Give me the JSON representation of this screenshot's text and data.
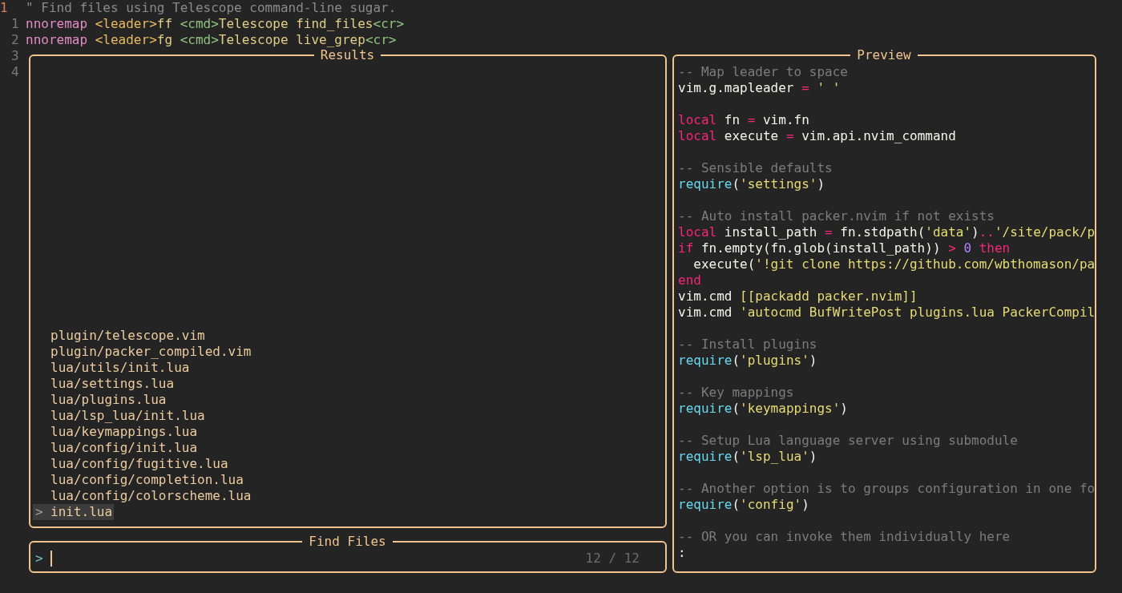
{
  "editor": {
    "lines": [
      {
        "number": "1",
        "current": true,
        "tokens": [
          {
            "kind": "comment",
            "text": "\" Find files using Telescope command-line sugar."
          }
        ]
      },
      {
        "number": "1",
        "current": false,
        "tokens": [
          {
            "kind": "keyword",
            "text": "nnoremap "
          },
          {
            "kind": "special",
            "text": "<leader>"
          },
          {
            "kind": "plain",
            "text": "ff "
          },
          {
            "kind": "tag",
            "text": "<cmd>"
          },
          {
            "kind": "plain",
            "text": "Telescope find_files"
          },
          {
            "kind": "tag",
            "text": "<cr>"
          }
        ]
      },
      {
        "number": "2",
        "current": false,
        "tokens": [
          {
            "kind": "keyword",
            "text": "nnoremap "
          },
          {
            "kind": "special",
            "text": "<leader>"
          },
          {
            "kind": "plain",
            "text": "fg "
          },
          {
            "kind": "tag",
            "text": "<cmd>"
          },
          {
            "kind": "plain",
            "text": "Telescope live_grep"
          },
          {
            "kind": "tag",
            "text": "<cr>"
          }
        ]
      },
      {
        "number": "3",
        "current": false
      },
      {
        "number": "4",
        "current": false
      }
    ]
  },
  "results": {
    "title": "Results",
    "caret": ">",
    "items": [
      {
        "path": "plugin/telescope.vim",
        "selected": false
      },
      {
        "path": "plugin/packer_compiled.vim",
        "selected": false
      },
      {
        "path": "lua/utils/init.lua",
        "selected": false
      },
      {
        "path": "lua/settings.lua",
        "selected": false
      },
      {
        "path": "lua/plugins.lua",
        "selected": false
      },
      {
        "path": "lua/lsp_lua/init.lua",
        "selected": false
      },
      {
        "path": "lua/keymappings.lua",
        "selected": false
      },
      {
        "path": "lua/config/init.lua",
        "selected": false
      },
      {
        "path": "lua/config/fugitive.lua",
        "selected": false
      },
      {
        "path": "lua/config/completion.lua",
        "selected": false
      },
      {
        "path": "lua/config/colorscheme.lua",
        "selected": false
      },
      {
        "path": "init.lua",
        "selected": true
      }
    ]
  },
  "prompt": {
    "title": "Find Files",
    "caret": ">",
    "count": "12 / 12"
  },
  "preview": {
    "title": "Preview",
    "lines": [
      {
        "kind": "code",
        "tokens": [
          {
            "kind": "comment",
            "text": "-- Map leader to space"
          }
        ]
      },
      {
        "kind": "code",
        "tokens": [
          {
            "kind": "plain",
            "text": "vim.g.mapleader "
          },
          {
            "kind": "operator",
            "text": "= "
          },
          {
            "kind": "string",
            "text": "' '"
          }
        ]
      },
      {
        "kind": "blank"
      },
      {
        "kind": "code",
        "tokens": [
          {
            "kind": "keyword",
            "text": "local"
          },
          {
            "kind": "plain",
            "text": " fn "
          },
          {
            "kind": "operator",
            "text": "="
          },
          {
            "kind": "plain",
            "text": " vim.fn"
          }
        ]
      },
      {
        "kind": "code",
        "tokens": [
          {
            "kind": "keyword",
            "text": "local"
          },
          {
            "kind": "plain",
            "text": " execute "
          },
          {
            "kind": "operator",
            "text": "="
          },
          {
            "kind": "plain",
            "text": " vim.api.nvim_command"
          }
        ]
      },
      {
        "kind": "blank"
      },
      {
        "kind": "code",
        "tokens": [
          {
            "kind": "comment",
            "text": "-- Sensible defaults"
          }
        ]
      },
      {
        "kind": "code",
        "tokens": [
          {
            "kind": "function",
            "text": "require"
          },
          {
            "kind": "plain",
            "text": "("
          },
          {
            "kind": "string",
            "text": "'settings'"
          },
          {
            "kind": "plain",
            "text": ")"
          }
        ]
      },
      {
        "kind": "blank"
      },
      {
        "kind": "code",
        "tokens": [
          {
            "kind": "comment",
            "text": "-- Auto install packer.nvim if not exists"
          }
        ]
      },
      {
        "kind": "code",
        "tokens": [
          {
            "kind": "keyword",
            "text": "local"
          },
          {
            "kind": "plain",
            "text": " install_path "
          },
          {
            "kind": "operator",
            "text": "="
          },
          {
            "kind": "plain",
            "text": " fn.stdpath("
          },
          {
            "kind": "string",
            "text": "'data'"
          },
          {
            "kind": "plain",
            "text": ")"
          },
          {
            "kind": "operator",
            "text": ".."
          },
          {
            "kind": "string",
            "text": "'/site/pack/p"
          }
        ]
      },
      {
        "kind": "code",
        "tokens": [
          {
            "kind": "keyword",
            "text": "if"
          },
          {
            "kind": "plain",
            "text": " fn.empty(fn.glob(install_path)) "
          },
          {
            "kind": "operator",
            "text": "> "
          },
          {
            "kind": "number",
            "text": "0 "
          },
          {
            "kind": "keyword",
            "text": "then"
          }
        ]
      },
      {
        "kind": "code",
        "tokens": [
          {
            "kind": "plain",
            "text": "  execute("
          },
          {
            "kind": "string",
            "text": "'!git clone https://github.com/wbthomason/pa"
          }
        ]
      },
      {
        "kind": "code",
        "tokens": [
          {
            "kind": "keyword",
            "text": "end"
          }
        ]
      },
      {
        "kind": "code",
        "tokens": [
          {
            "kind": "plain",
            "text": "vim.cmd "
          },
          {
            "kind": "string",
            "text": "[[packadd packer.nvim]]"
          }
        ]
      },
      {
        "kind": "code",
        "tokens": [
          {
            "kind": "plain",
            "text": "vim.cmd "
          },
          {
            "kind": "string",
            "text": "'autocmd BufWritePost plugins.lua PackerCompil"
          }
        ]
      },
      {
        "kind": "blank"
      },
      {
        "kind": "code",
        "tokens": [
          {
            "kind": "comment",
            "text": "-- Install plugins"
          }
        ]
      },
      {
        "kind": "code",
        "tokens": [
          {
            "kind": "function",
            "text": "require"
          },
          {
            "kind": "plain",
            "text": "("
          },
          {
            "kind": "string",
            "text": "'plugins'"
          },
          {
            "kind": "plain",
            "text": ")"
          }
        ]
      },
      {
        "kind": "blank"
      },
      {
        "kind": "code",
        "tokens": [
          {
            "kind": "comment",
            "text": "-- Key mappings"
          }
        ]
      },
      {
        "kind": "code",
        "tokens": [
          {
            "kind": "function",
            "text": "require"
          },
          {
            "kind": "plain",
            "text": "("
          },
          {
            "kind": "string",
            "text": "'keymappings'"
          },
          {
            "kind": "plain",
            "text": ")"
          }
        ]
      },
      {
        "kind": "blank"
      },
      {
        "kind": "code",
        "tokens": [
          {
            "kind": "comment",
            "text": "-- Setup Lua language server using submodule"
          }
        ]
      },
      {
        "kind": "code",
        "tokens": [
          {
            "kind": "function",
            "text": "require"
          },
          {
            "kind": "plain",
            "text": "("
          },
          {
            "kind": "string",
            "text": "'lsp_lua'"
          },
          {
            "kind": "plain",
            "text": ")"
          }
        ]
      },
      {
        "kind": "blank"
      },
      {
        "kind": "code",
        "tokens": [
          {
            "kind": "comment",
            "text": "-- Another option is to groups configuration in one fo"
          }
        ]
      },
      {
        "kind": "code",
        "tokens": [
          {
            "kind": "function",
            "text": "require"
          },
          {
            "kind": "plain",
            "text": "("
          },
          {
            "kind": "string",
            "text": "'config'"
          },
          {
            "kind": "plain",
            "text": ")"
          }
        ]
      },
      {
        "kind": "blank"
      },
      {
        "kind": "code",
        "tokens": [
          {
            "kind": "comment",
            "text": "-- OR you can invoke them individually here"
          }
        ]
      },
      {
        "kind": "code",
        "tokens": [
          {
            "kind": "plain",
            "text": ":"
          }
        ]
      }
    ]
  }
}
